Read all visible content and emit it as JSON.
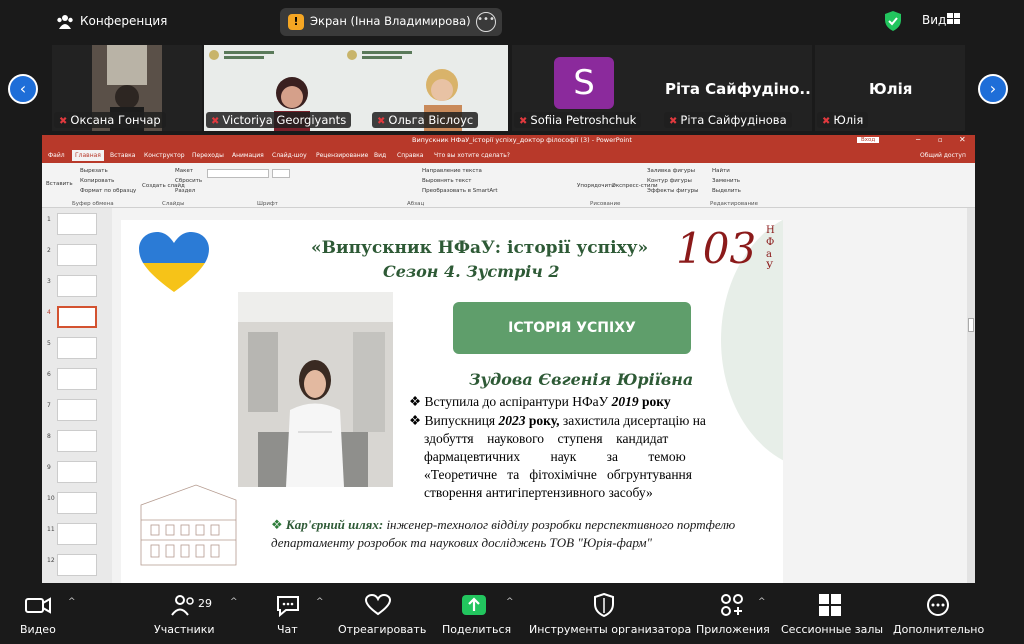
{
  "topbar": {
    "conference_label": "Конференция",
    "screen_badge": "!",
    "screen_title": "Экран (Інна Владимирова)",
    "view_label": "Вид"
  },
  "participants": {
    "tiles": [
      {
        "name": "Оксана Гончар"
      },
      {
        "name": "Victoriya Georgiyants"
      },
      {
        "name": "Ольга Віслоус"
      },
      {
        "name": "Sofiia Petroshchuk",
        "avatar_letter": "S"
      },
      {
        "name": "Ріта Сайфудінова",
        "big_name": "Ріта  Сайфудіно..."
      },
      {
        "name": "Юлія",
        "big_name": "Юлія"
      }
    ]
  },
  "ppt": {
    "title": "Випускник НФаУ_історії успіху_доктор філософії (3)  -  PowerPoint",
    "signin": "Вход",
    "menu": [
      "Файл",
      "Главная",
      "Вставка",
      "Конструктор",
      "Переходы",
      "Анимация",
      "Слайд-шоу",
      "Рецензирование",
      "Вид",
      "Справка",
      "Что вы хотите сделать?"
    ],
    "share": "Общий доступ",
    "ribbon": {
      "paste": "Вставить",
      "cut": "Вырезать",
      "copy": "Копировать",
      "format_painter": "Формат по образцу",
      "new_slide": "Создать слайд",
      "layout": "Макет",
      "reset": "Сбросить",
      "section": "Раздел",
      "text_direction": "Направление текста",
      "align_text": "Выровнять текст",
      "smartart": "Преобразовать в SmartArt",
      "arrange": "Упорядочить",
      "quick_styles": "Экспресс-стили",
      "shape_fill": "Заливка фигуры",
      "shape_outline": "Контур фигуры",
      "shape_effects": "Эффекты фигуры",
      "find": "Найти",
      "replace": "Заменить",
      "select": "Выделить",
      "groups": [
        "Буфер обмена",
        "Слайды",
        "Шрифт",
        "Абзац",
        "Рисование",
        "Редактирование"
      ]
    },
    "thumb_numbers": [
      "1",
      "2",
      "3",
      "4",
      "5",
      "6",
      "7",
      "8",
      "9",
      "10",
      "11",
      "12"
    ]
  },
  "slide": {
    "title1": "«Випускник НФаУ: історії успіху»",
    "title2": "Сезон 4. Зустріч 2",
    "logo_number": "103",
    "logo_letters": "НФаУ",
    "story_button": "ІСТОРІЯ УСПІХУ",
    "person_name": "Зудова Євгенія Юріївна",
    "bullet1_pre": "Вступила до аспірантури НФаУ ",
    "bullet1_year": "2019",
    "bullet1_post": " року",
    "bullet2_pre": "Випускниця ",
    "bullet2_year": "2023",
    "bullet2_bold": " року,",
    "bullet2_line1_rest": " захистила дисертацію на",
    "bullet2_line2": "здобуття    наукового    ступеня    кандидат",
    "bullet2_line3": "фармацевтичних         наук         за         темою",
    "bullet2_line4": "«Теоретичне   та   фітохімічне   обгрунтування",
    "bullet2_line5": "створення антигіпертензивного засобу»",
    "career_label": "Кар'єрний шлях:",
    "career_text": " інженер-технолог відділу розробки перспективного портфелю департаменту розробок та наукових досліджень ТОВ \"Юрія-фарм\""
  },
  "bottombar": {
    "video": "Видео",
    "participants": "Участники",
    "participants_count": "29",
    "chat": "Чат",
    "react": "Отреагировать",
    "share": "Поделиться",
    "host_tools": "Инструменты организатора",
    "apps": "Приложения",
    "breakout": "Сессионные залы",
    "more": "Дополнительно"
  },
  "colors": {
    "ppt_red": "#b8392a",
    "slide_green": "#2e5a36",
    "button_green": "#5f9e6b",
    "zoom_blue": "#1e6ed8",
    "share_green": "#22c55e"
  }
}
